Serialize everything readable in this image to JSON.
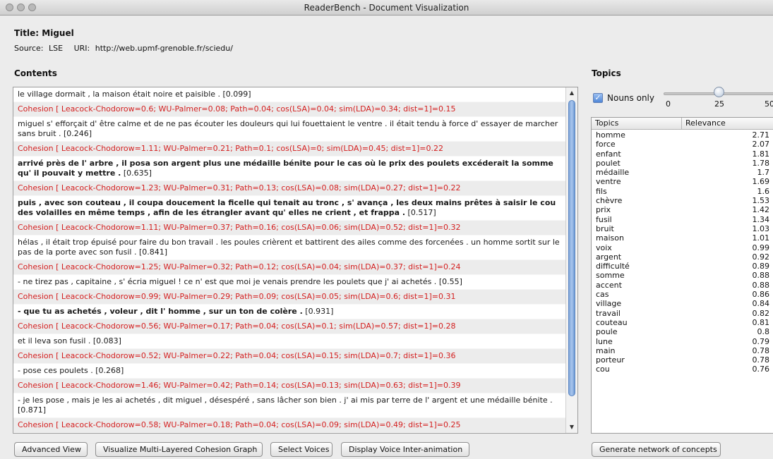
{
  "window": {
    "title": "ReaderBench - Document Visualization"
  },
  "document": {
    "title_label": "Title:",
    "title_value": "Miguel",
    "source_label": "Source:",
    "source_value": "LSE",
    "uri_label": "URI:",
    "uri_value": "http://web.upmf-grenoble.fr/sciedu/"
  },
  "contents": {
    "heading": "Contents",
    "rows": [
      {
        "kind": "text",
        "bold": false,
        "sentence": "le village dormait , la maison était noire et paisible .",
        "score": "[0.099]"
      },
      {
        "kind": "cohesion",
        "text": "Cohesion [ Leacock-Chodorow=0.6; WU-Palmer=0.08; Path=0.04; cos(LSA)=0.04; sim(LDA)=0.34; dist=1]=0.15"
      },
      {
        "kind": "text",
        "bold": false,
        "sentence": "miguel s' efforçait d' être calme et de ne pas écouter les douleurs qui lui fouettaient le ventre . il était tendu à force d' essayer de marcher sans bruit .",
        "score": "[0.246]"
      },
      {
        "kind": "cohesion",
        "text": "Cohesion [ Leacock-Chodorow=1.11; WU-Palmer=0.21; Path=0.1; cos(LSA)=0; sim(LDA)=0.45; dist=1]=0.22"
      },
      {
        "kind": "text",
        "bold": true,
        "sentence": "arrivé près de l' arbre , il posa son argent plus une médaille bénite pour le cas où le prix des poulets excéderait la somme qu' il pouvait y mettre .",
        "score": "[0.635]"
      },
      {
        "kind": "cohesion",
        "text": "Cohesion [ Leacock-Chodorow=1.23; WU-Palmer=0.31; Path=0.13; cos(LSA)=0.08; sim(LDA)=0.27; dist=1]=0.22"
      },
      {
        "kind": "text",
        "bold": true,
        "sentence": "puis , avec son couteau , il coupa doucement la ficelle qui tenait au tronc , s' avança , les deux mains prêtes à saisir le cou des volailles en même temps , afin de les étrangler avant qu' elles ne crient , et frappa .",
        "score": "[0.517]"
      },
      {
        "kind": "cohesion",
        "text": "Cohesion [ Leacock-Chodorow=1.11; WU-Palmer=0.37; Path=0.16; cos(LSA)=0.06; sim(LDA)=0.52; dist=1]=0.32"
      },
      {
        "kind": "text",
        "bold": false,
        "sentence": "hélas , il était trop épuisé pour faire du bon travail . les poules crièrent et battirent des ailes comme des forcenées . un homme sortit sur le pas de la porte avec son fusil .",
        "score": "[0.841]"
      },
      {
        "kind": "cohesion",
        "text": "Cohesion [ Leacock-Chodorow=1.25; WU-Palmer=0.32; Path=0.12; cos(LSA)=0.04; sim(LDA)=0.37; dist=1]=0.24"
      },
      {
        "kind": "text",
        "bold": false,
        "sentence": "- ne tirez pas , capitaine , s' écria miguel ! ce n' est que moi je venais prendre les poulets que j' ai achetés .",
        "score": "[0.55]"
      },
      {
        "kind": "cohesion",
        "text": "Cohesion [ Leacock-Chodorow=0.99; WU-Palmer=0.29; Path=0.09; cos(LSA)=0.05; sim(LDA)=0.6; dist=1]=0.31"
      },
      {
        "kind": "text",
        "bold": true,
        "sentence": "- que tu as achetés , voleur , dit l' homme , sur un ton de colère .",
        "score": "[0.931]"
      },
      {
        "kind": "cohesion",
        "text": "Cohesion [ Leacock-Chodorow=0.56; WU-Palmer=0.17; Path=0.04; cos(LSA)=0.1; sim(LDA)=0.57; dist=1]=0.28"
      },
      {
        "kind": "text",
        "bold": false,
        "sentence": "et il leva son fusil .",
        "score": "[0.083]"
      },
      {
        "kind": "cohesion",
        "text": "Cohesion [ Leacock-Chodorow=0.52; WU-Palmer=0.22; Path=0.04; cos(LSA)=0.15; sim(LDA)=0.7; dist=1]=0.36"
      },
      {
        "kind": "text",
        "bold": false,
        "sentence": "- pose ces poulets .",
        "score": "[0.268]"
      },
      {
        "kind": "cohesion",
        "text": "Cohesion [ Leacock-Chodorow=1.46; WU-Palmer=0.42; Path=0.14; cos(LSA)=0.13; sim(LDA)=0.63; dist=1]=0.39"
      },
      {
        "kind": "text",
        "bold": false,
        "sentence": "- je les pose , mais je les ai achetés , dit miguel , désespéré , sans lâcher son bien . j' ai mis par terre de l' argent et une médaille bénite .",
        "score": "[0.871]"
      },
      {
        "kind": "cohesion",
        "text": "Cohesion [ Leacock-Chodorow=0.58; WU-Palmer=0.18; Path=0.04; cos(LSA)=0.09; sim(LDA)=0.49; dist=1]=0.25"
      }
    ]
  },
  "buttons": {
    "advanced_view": "Advanced View",
    "visualize_graph": "Visualize Multi-Layered Cohesion Graph",
    "select_voices": "Select Voices",
    "display_voice": "Display Voice Inter-animation",
    "generate_network": "Generate network of concepts"
  },
  "topics": {
    "heading": "Topics",
    "nouns_only_label": "Nouns only",
    "nouns_only_checked": true,
    "slider_ticks": [
      "0",
      "25",
      "50"
    ],
    "slider_value": 25,
    "col_topic": "Topics",
    "col_relevance": "Relevance",
    "rows": [
      {
        "topic": "homme",
        "relevance": "2.71"
      },
      {
        "topic": "force",
        "relevance": "2.07"
      },
      {
        "topic": "enfant",
        "relevance": "1.81"
      },
      {
        "topic": "poulet",
        "relevance": "1.78"
      },
      {
        "topic": "médaille",
        "relevance": "1.7"
      },
      {
        "topic": "ventre",
        "relevance": "1.69"
      },
      {
        "topic": "fils",
        "relevance": "1.6"
      },
      {
        "topic": "chèvre",
        "relevance": "1.53"
      },
      {
        "topic": "prix",
        "relevance": "1.42"
      },
      {
        "topic": "fusil",
        "relevance": "1.34"
      },
      {
        "topic": "bruit",
        "relevance": "1.03"
      },
      {
        "topic": "maison",
        "relevance": "1.01"
      },
      {
        "topic": "voix",
        "relevance": "0.99"
      },
      {
        "topic": "argent",
        "relevance": "0.92"
      },
      {
        "topic": "difficulté",
        "relevance": "0.89"
      },
      {
        "topic": "somme",
        "relevance": "0.88"
      },
      {
        "topic": "accent",
        "relevance": "0.88"
      },
      {
        "topic": "cas",
        "relevance": "0.86"
      },
      {
        "topic": "village",
        "relevance": "0.84"
      },
      {
        "topic": "travail",
        "relevance": "0.82"
      },
      {
        "topic": "couteau",
        "relevance": "0.81"
      },
      {
        "topic": "poule",
        "relevance": "0.8"
      },
      {
        "topic": "lune",
        "relevance": "0.79"
      },
      {
        "topic": "main",
        "relevance": "0.78"
      },
      {
        "topic": "porteur",
        "relevance": "0.78"
      },
      {
        "topic": "cou",
        "relevance": "0.76"
      }
    ]
  },
  "colors": {
    "cohesion_text": "#d42020",
    "scroll_thumb": "#7fa5d8"
  }
}
